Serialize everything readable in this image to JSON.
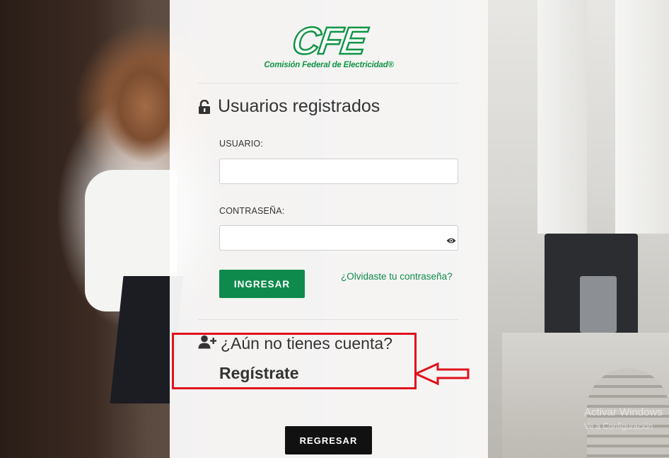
{
  "brand": {
    "logo_mark": "CFE",
    "logo_subtitle": "Comisión Federal de Electricidad®",
    "brand_color": "#119446"
  },
  "login": {
    "title": "Usuarios registrados",
    "title_icon": "unlock-icon",
    "username_label": "USUARIO:",
    "username_value": "",
    "password_label": "CONTRASEÑA:",
    "password_value": "",
    "show_password_icon": "eye-icon",
    "submit_label": "INGRESAR",
    "forgot_label": "¿Olvidaste tu contraseña?"
  },
  "register": {
    "title": "¿Aún no tienes cuenta?",
    "title_icon": "user-plus-icon",
    "link_label": "Regístrate",
    "highlight_color": "#e0121c"
  },
  "footer": {
    "back_label": "REGRESAR"
  },
  "os_watermark": {
    "line1": "Activar Windows",
    "line2": "Ve a Configuración"
  },
  "colors": {
    "primary_green": "#0f8a4d",
    "dark_button": "#111111"
  }
}
